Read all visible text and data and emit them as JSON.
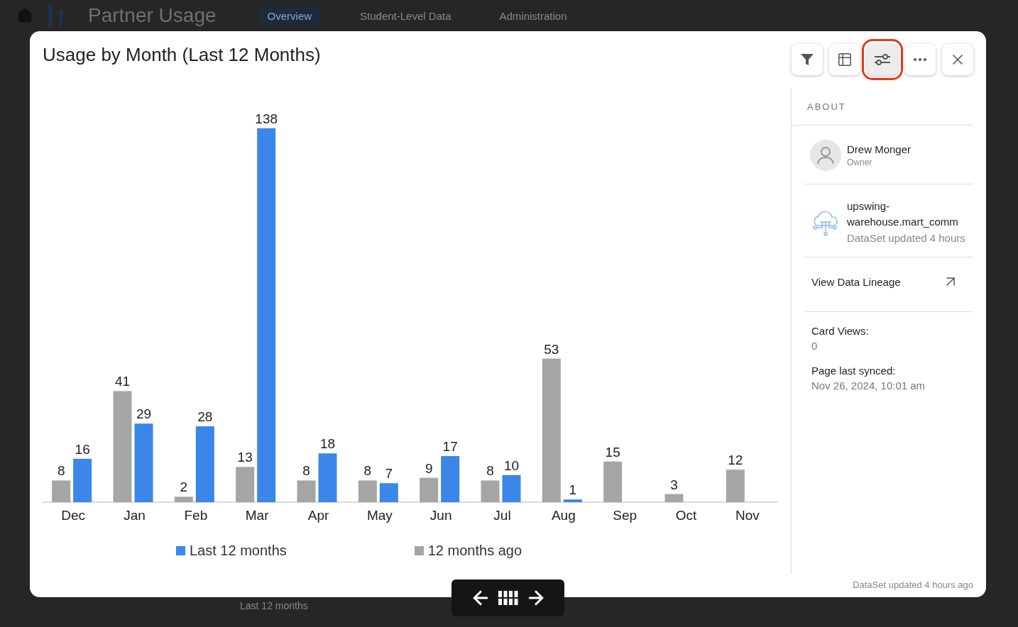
{
  "background": {
    "title": "Partner Usage",
    "tabs": [
      {
        "label": "Overview",
        "selected": true
      },
      {
        "label": "Student-Level Data",
        "selected": false
      },
      {
        "label": "Administration",
        "selected": false
      }
    ],
    "legend_text": "Last 12 months"
  },
  "modal": {
    "title": "Usage by Month (Last 12 Months)",
    "toolbar": [
      {
        "kind": "filter",
        "selected": false
      },
      {
        "kind": "table",
        "selected": false
      },
      {
        "kind": "settings",
        "selected": true
      },
      {
        "kind": "more",
        "selected": false
      },
      {
        "kind": "close",
        "selected": false
      }
    ],
    "chart_data": {
      "type": "bar",
      "categories": [
        "Dec",
        "Jan",
        "Feb",
        "Mar",
        "Apr",
        "May",
        "Jun",
        "Jul",
        "Aug",
        "Sep",
        "Oct",
        "Nov"
      ],
      "series": [
        {
          "name": "Last 12 months",
          "color": "#3b86e8",
          "values": [
            16,
            29,
            28,
            138,
            18,
            7,
            17,
            10,
            1,
            null,
            null,
            null
          ]
        },
        {
          "name": "12 months ago",
          "color": "#a5a5a5",
          "values": [
            8,
            41,
            2,
            13,
            8,
            8,
            9,
            8,
            53,
            15,
            3,
            12
          ]
        }
      ],
      "data_labels": true
    },
    "about": {
      "heading": "ABOUT",
      "owner": {
        "name": "Drew Monger",
        "role": "Owner"
      },
      "dataset": {
        "name": "upswing-warehouse.mart_comm",
        "updated": "DataSet updated 4 hours"
      },
      "lineage": "View Data Lineage",
      "stats": [
        {
          "label": "Card Views:",
          "value": "0"
        },
        {
          "label": "Page last synced:",
          "value": "Nov 26, 2024, 10:01 am"
        }
      ]
    },
    "footer": "DataSet updated 4 hours ago"
  }
}
